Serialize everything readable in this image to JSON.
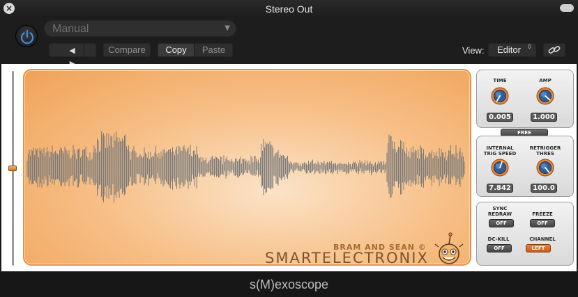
{
  "window": {
    "title": "Stereo Out",
    "close_glyph": "×"
  },
  "host": {
    "preset": "Manual",
    "preset_arrow": "▼",
    "prev_glyph": "◀",
    "next_glyph": "▶",
    "compare_label": "Compare",
    "copy_label": "Copy",
    "paste_label": "Paste",
    "view_label": "View:",
    "view_value": "Editor",
    "view_arrows": "⇕"
  },
  "plugin": {
    "brand_credit": "BRAM AND SEAN ©",
    "brand_name": "SMARTELECTRONIX",
    "controls": {
      "time": {
        "label": "TIME",
        "value": "0.005"
      },
      "amp": {
        "label": "AMP",
        "value": "1.000"
      },
      "free_label": "FREE",
      "trig_speed": {
        "label_line1": "INTERNAL",
        "label_line2": "TRIG SPEED",
        "value": "7.842"
      },
      "retrigger": {
        "label_line1": "RETRIGGER",
        "label_line2": "THRES",
        "value": "100.0"
      },
      "sync_redraw": {
        "label_line1": "SYNC",
        "label_line2": "REDRAW",
        "state": "OFF"
      },
      "freeze": {
        "label": "FREEZE",
        "state": "OFF"
      },
      "dc_kill": {
        "label": "DC-KILL",
        "state": "OFF"
      },
      "channel": {
        "label": "CHANNEL",
        "state": "LEFT"
      }
    },
    "colors": {
      "accent": "#e8843c",
      "scope_edge": "#e49346",
      "wave": "#7a7a7a"
    }
  },
  "footer": {
    "title": "s(M)exoscope"
  },
  "icons": [
    "close-icon",
    "power-icon",
    "link-icon",
    "mascot-icon"
  ]
}
